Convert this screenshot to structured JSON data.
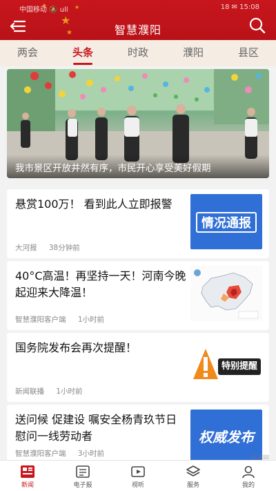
{
  "status_bar": {
    "carrier": "中国移动 🔕 ull",
    "right": "18 ✉ 15:08"
  },
  "header": {
    "title": "智慧濮阳",
    "menu_icon": "menu-back-icon",
    "search_icon": "search-icon"
  },
  "tabs": [
    {
      "label": "两会"
    },
    {
      "label": "头条",
      "active": true
    },
    {
      "label": "时政"
    },
    {
      "label": "濮阳"
    },
    {
      "label": "县区"
    }
  ],
  "hero": {
    "caption": "我市景区开放井然有序，市民开心享受美好假期"
  },
  "news": [
    {
      "title": "悬赏100万！ 看到此人立即报警",
      "source": "大河报",
      "time": "38分钟前",
      "thumb_text": "情况通报"
    },
    {
      "title": "40°C高温！再坚持一天！河南今晚起迎来大降温！",
      "source": "智慧濮阳客户端",
      "time": "1小时前",
      "thumb_text": ""
    },
    {
      "title": "国务院发布会再次提醒！",
      "source": "新闻联播",
      "time": "1小时前",
      "thumb_text": "特别提醒"
    },
    {
      "title": "送问候 促建设 嘱安全杨青玖节日慰问一线劳动者",
      "source": "智慧濮阳客户端",
      "time": "3小时前",
      "thumb_text": "权威发布"
    }
  ],
  "bottom_nav": [
    {
      "label": "新闻",
      "icon": "news-icon",
      "active": true
    },
    {
      "label": "电子报",
      "icon": "epaper-icon"
    },
    {
      "label": "视听",
      "icon": "video-icon"
    },
    {
      "label": "服务",
      "icon": "service-icon"
    },
    {
      "label": "我的",
      "icon": "profile-icon"
    }
  ],
  "watermark": {
    "main": "2265",
    "sub": "手游网"
  },
  "colors": {
    "brand_red": "#c8161d",
    "tab_bg": "#f5ece4",
    "report_blue": "#2f6fd6"
  }
}
